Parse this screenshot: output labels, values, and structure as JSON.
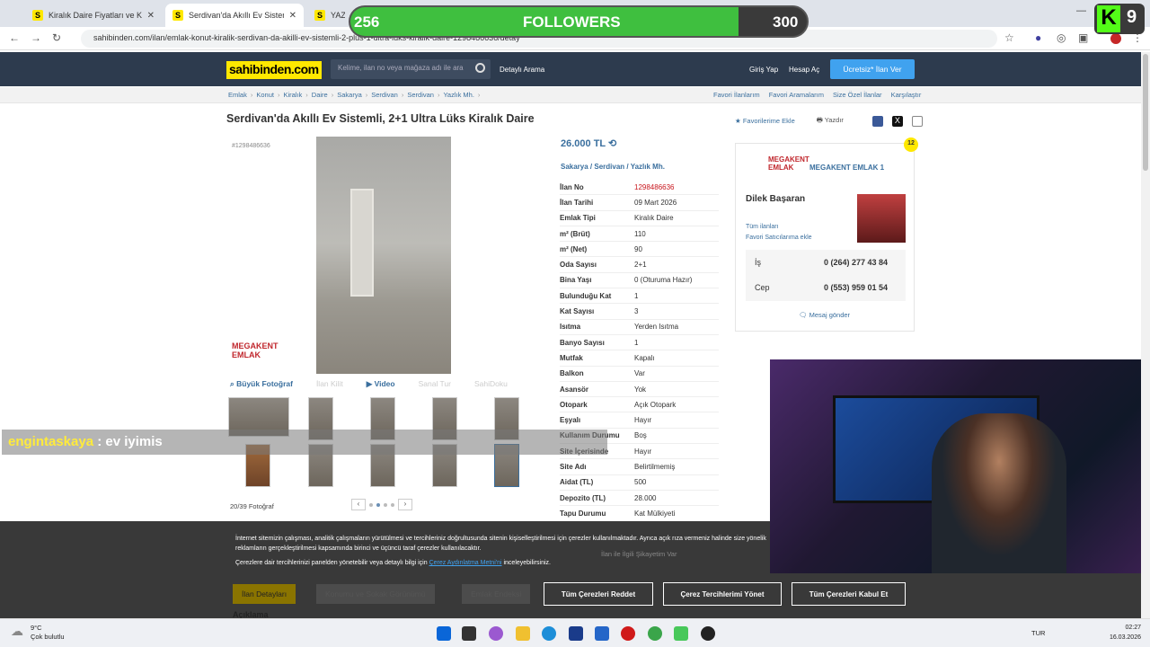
{
  "browser": {
    "tabs": [
      {
        "label": "Kiralık Daire Fiyatları ve Kiralık E",
        "favicon": "S"
      },
      {
        "label": "Serdivan'da Akıllı Ev Sistemli, 2+",
        "favicon": "S"
      },
      {
        "label": "YAZL",
        "favicon": "S"
      }
    ],
    "url": "sahibinden.com/ilan/emlak-konut-kiralik-serdivan-da-akilli-ev-sistemli-2-plus-1-ultra-luks-kiralik-daire-1298486636/detay"
  },
  "header": {
    "logo": "sahibinden.com",
    "search_placeholder": "Kelime, ilan no veya mağaza adı ile ara",
    "detailed_search": "Detaylı Arama",
    "login": "Giriş Yap",
    "register": "Hesap Aç",
    "free_listing": "Ücretsiz* İlan Ver"
  },
  "breadcrumb": [
    "Emlak",
    "Konut",
    "Kiralık",
    "Daire",
    "Sakarya",
    "Serdivan",
    "Serdivan",
    "Yazlık Mh."
  ],
  "breadcrumb_right": [
    "Favori İlanlarım",
    "Favori Aramalarım",
    "Size Özel İlanlar",
    "Karşılaştır"
  ],
  "listing": {
    "title": "Serdivan'da Akıllı Ev Sistemli, 2+1 Ultra Lüks Kiralık Daire",
    "add_favorite": "Favorilerime Ekle",
    "print": "Yazdır",
    "id_label": "#1298486636",
    "price": "26.000 TL",
    "location": [
      "Sakarya",
      "Serdivan",
      "Yazlık Mh."
    ],
    "watermark": "MEGAKENT EMLAK",
    "photo_tools": [
      "Büyük Fotoğraf",
      "İlan Kilit",
      "Video",
      "Sanal Tur",
      "SahiDoku"
    ],
    "photo_count": "20/39 Fotoğraf",
    "details": [
      {
        "k": "İlan No",
        "v": "1298486636"
      },
      {
        "k": "İlan Tarihi",
        "v": "09 Mart 2026"
      },
      {
        "k": "Emlak Tipi",
        "v": "Kiralık Daire"
      },
      {
        "k": "m² (Brüt)",
        "v": "110"
      },
      {
        "k": "m² (Net)",
        "v": "90"
      },
      {
        "k": "Oda Sayısı",
        "v": "2+1"
      },
      {
        "k": "Bina Yaşı",
        "v": "0 (Oturuma Hazır)"
      },
      {
        "k": "Bulunduğu Kat",
        "v": "1"
      },
      {
        "k": "Kat Sayısı",
        "v": "3"
      },
      {
        "k": "Isıtma",
        "v": "Yerden Isıtma"
      },
      {
        "k": "Banyo Sayısı",
        "v": "1"
      },
      {
        "k": "Mutfak",
        "v": "Kapalı"
      },
      {
        "k": "Balkon",
        "v": "Var"
      },
      {
        "k": "Asansör",
        "v": "Yok"
      },
      {
        "k": "Otopark",
        "v": "Açık Otopark"
      },
      {
        "k": "Eşyalı",
        "v": "Hayır"
      },
      {
        "k": "Kullanım Durumu",
        "v": "Boş"
      },
      {
        "k": "Site İçerisinde",
        "v": "Hayır"
      },
      {
        "k": "Site Adı",
        "v": "Belirtilmemiş"
      },
      {
        "k": "Aidat (TL)",
        "v": "500"
      },
      {
        "k": "Depozito (TL)",
        "v": "28.000"
      },
      {
        "k": "Tapu Durumu",
        "v": "Kat Mülkiyeti"
      }
    ]
  },
  "seller": {
    "badge": "12",
    "store_name": "MEGAKENT EMLAK 1",
    "agent": "Dilek Başaran",
    "all_listings": "Tüm ilanları",
    "favorite_sellers": "Favori Satıcılarıma ekle",
    "phone_work_label": "İş",
    "phone_work": "0 (264) 277 43 84",
    "phone_mobile_label": "Cep",
    "phone_mobile": "0 (553) 959 01 54",
    "message": "Mesaj gönder"
  },
  "stream": {
    "followers_current": "256",
    "followers_label": "FOLLOWERS",
    "followers_goal": "300",
    "followers_progress": 0.85,
    "kick_number": "9",
    "chat_user": "engintaskaya",
    "chat_message": " : ev iyimis"
  },
  "cookie": {
    "text1": "İnternet sitemizin çalışması, analitik çalışmaların yürütülmesi ve tercihleriniz doğrultusunda sitenin kişiselleştirilmesi için çerezler kullanılmaktadır. Ayrıca açık rıza vermeniz halinde size yönelik reklamların gerçekleştirilmesi kapsamında birinci ve üçüncü taraf çerezler kullanılacaktır.",
    "text2_pre": "Çerezlere dair tercihlerinizi panelden yönetebilir veya detaylı bilgi için",
    "text2_link": "Çerez Aydınlatma Metni'ni",
    "text2_post": "inceleyebilirsiniz.",
    "reject": "Tüm Çerezleri Reddet",
    "manage": "Çerez Tercihlerimi Yönet",
    "accept": "Tüm Çerezleri Kabul Et",
    "bg_tabs": [
      "İlan Detayları",
      "Konumu ve Sokak Görünümü",
      "Emlak Endeksi"
    ],
    "report": "İlan ile İlgili Şikayetim Var",
    "section": "Açıklama"
  },
  "taskbar": {
    "temp": "9°C",
    "weather": "Çok bulutlu",
    "lang": "TUR",
    "time": "02:27",
    "date": "16.03.2026"
  }
}
